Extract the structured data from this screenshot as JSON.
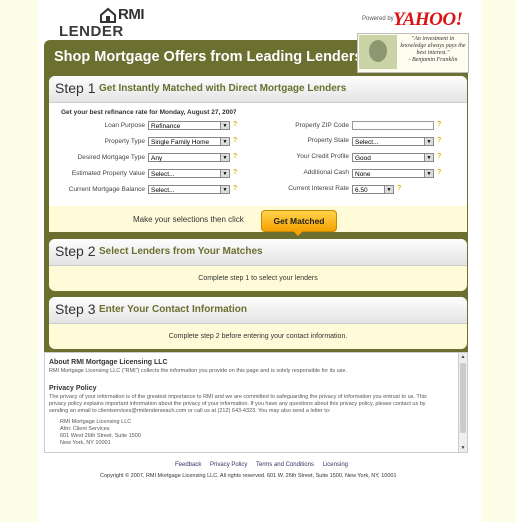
{
  "brand": {
    "logo_top": "RMI",
    "logo_bottom": "LENDER SEARCH",
    "powered_by": "Powered by",
    "partner": "YAHOO!"
  },
  "banner": {
    "title": "Shop Mortgage Offers from Leading Lenders",
    "quote": "\"An investment in knowledge always pays the best interest.\"",
    "quote_author": "- Benjamin Franklin"
  },
  "step1": {
    "num": "Step 1",
    "title": "Get Instantly Matched with Direct Mortgage Lenders",
    "subtitle": "Get your best refinance rate for Monday, August 27, 2007",
    "fields_left": [
      {
        "label": "Loan Purpose",
        "value": "Refinance"
      },
      {
        "label": "Property Type",
        "value": "Single Family Home"
      },
      {
        "label": "Desired Mortgage Type",
        "value": "Any"
      },
      {
        "label": "Estimated Property Value",
        "value": "Select..."
      },
      {
        "label": "Current Mortgage Balance",
        "value": "Select..."
      }
    ],
    "fields_right": [
      {
        "label": "Property ZIP Code",
        "value": ""
      },
      {
        "label": "Property State",
        "value": "Select..."
      },
      {
        "label": "Your Credit Profile",
        "value": "Good"
      },
      {
        "label": "Additional Cash",
        "value": "None"
      },
      {
        "label": "Current Interest Rate",
        "value": "6.50"
      }
    ],
    "cta_text": "Make your selections then click",
    "cta_button": "Get Matched"
  },
  "step2": {
    "num": "Step 2",
    "title": "Select Lenders from Your Matches",
    "note": "Complete step 1 to select your lenders"
  },
  "step3": {
    "num": "Step 3",
    "title": "Enter Your Contact Information",
    "note": "Complete step 2 before entering your contact information."
  },
  "legal": {
    "about_heading": "About RMI Mortgage Licensing LLC",
    "about_text": "RMI Mortgage Licensing LLC (\"RMI\") collects the information you provide on this page and is solely responsible for its use.",
    "privacy_heading": "Privacy Policy",
    "privacy_text_1": "The privacy of your information is of the greatest importance to RMI and we are committed to safeguarding the privacy of information you entrust to us. This",
    "privacy_text_2": "privacy policy explains important information about the privacy of your information. If you have any questions about this privacy policy, please contact us by",
    "privacy_text_3": "sending an email to clientservices@rmilenderseach.com or call us at (212) 643-4323. You may also send a letter to:",
    "address": [
      "RMI Mortgage Licensing LLC",
      "Attn: Client Services",
      "601 West 26th Street, Suite 1500",
      "New York, NY 10001"
    ]
  },
  "footer": {
    "links": [
      "Feedback",
      "Privacy Policy",
      "Terms and Conditions",
      "Licensing"
    ],
    "copyright": "Copyright © 2007, RMI Mortgage Licensing LLC. All rights reserved. 601 W. 26th Street, Suite 1500, New York, NY, 10001"
  }
}
